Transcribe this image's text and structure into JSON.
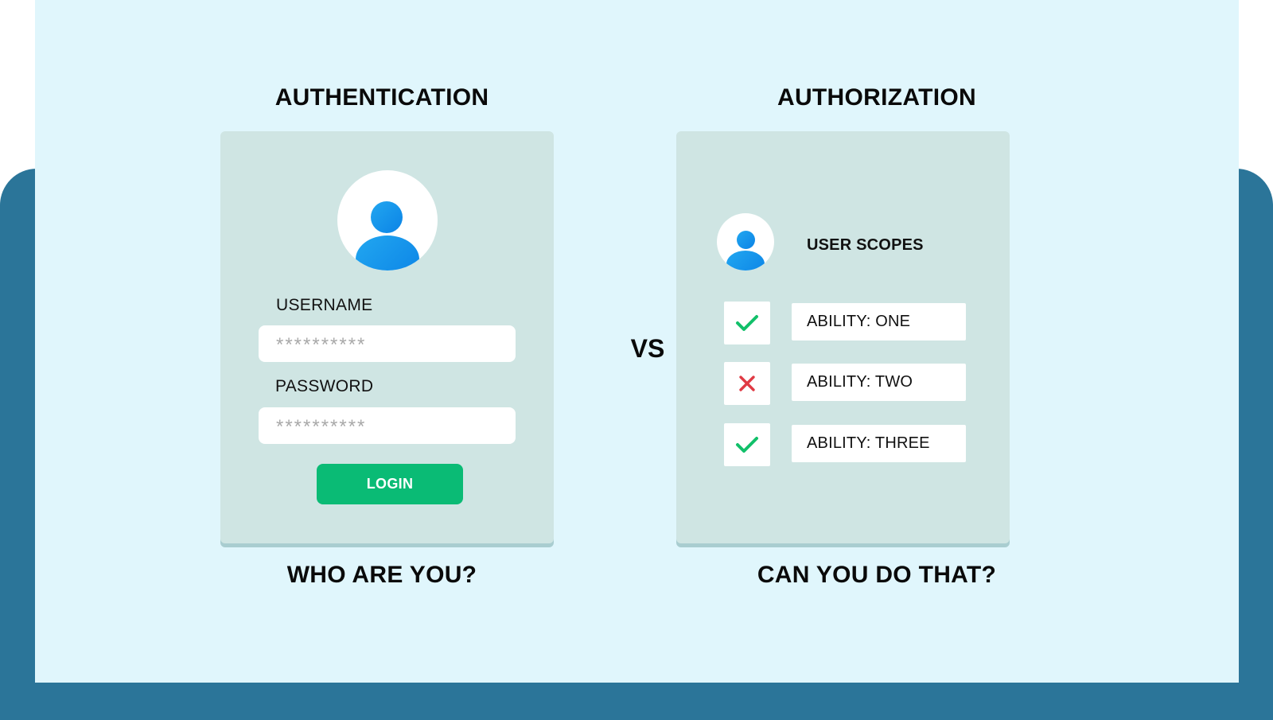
{
  "authentication": {
    "title": "AUTHENTICATION",
    "username_label": "USERNAME",
    "username_value": "**********",
    "password_label": "PASSWORD",
    "password_value": "**********",
    "login_label": "LOGIN",
    "caption": "WHO ARE YOU?"
  },
  "versus": "VS",
  "authorization": {
    "title": "AUTHORIZATION",
    "scopes_label": "USER SCOPES",
    "scopes": [
      {
        "label": "ABILITY: ONE",
        "status": "allowed",
        "icon": "check-icon"
      },
      {
        "label": "ABILITY: TWO",
        "status": "denied",
        "icon": "cross-icon"
      },
      {
        "label": "ABILITY: THREE",
        "status": "allowed",
        "icon": "check-icon"
      }
    ],
    "caption": "CAN YOU DO THAT?"
  },
  "colors": {
    "background": "#e0f6fc",
    "frame": "#2b7599",
    "card": "#cfe5e3",
    "login_button": "#0abb75",
    "check": "#12c06a",
    "cross": "#e03a44",
    "avatar": "#0b83e6"
  }
}
